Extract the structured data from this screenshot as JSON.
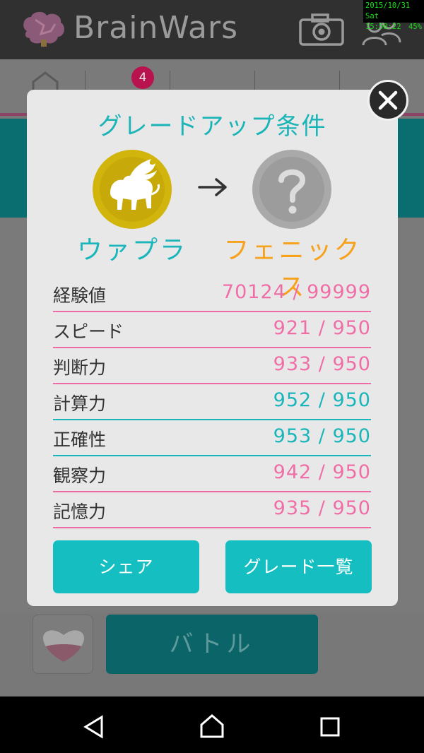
{
  "status_bar": {
    "date": "2015/10/31 Sat",
    "time": "15:50:22",
    "battery": "45%"
  },
  "app": {
    "title": "BrainWars",
    "notification_count": "4",
    "battle_label": "バトル"
  },
  "modal": {
    "title": "グレードアップ条件",
    "current_grade": "ウァプラ",
    "next_grade": "フェニックス",
    "stats": [
      {
        "label": "経験値",
        "value": "70124 / 99999",
        "color": "pink"
      },
      {
        "label": "スピード",
        "value": "921 / 950",
        "color": "pink"
      },
      {
        "label": "判断力",
        "value": "933 / 950",
        "color": "pink"
      },
      {
        "label": "計算力",
        "value": "952 / 950",
        "color": "teal"
      },
      {
        "label": "正確性",
        "value": "953 / 950",
        "color": "teal"
      },
      {
        "label": "観察力",
        "value": "942 / 950",
        "color": "pink"
      },
      {
        "label": "記憶力",
        "value": "935 / 950",
        "color": "pink"
      }
    ],
    "share_button": "シェア",
    "grade_list_button": "グレード一覧"
  },
  "colors": {
    "teal": "#19b6b9",
    "pink": "#ee6aa3",
    "orange": "#f6a21c",
    "gold": "#d4b70c"
  },
  "icons": {
    "close": "close-icon",
    "arrow": "arrow-right-icon",
    "camera": "camera-icon",
    "friends": "friends-icon"
  }
}
